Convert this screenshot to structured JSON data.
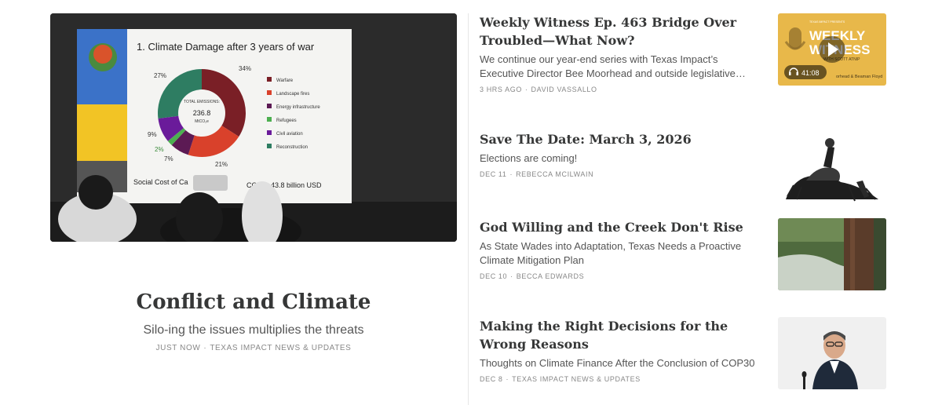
{
  "featured": {
    "title": "Conflict and Climate",
    "subtitle": "Silo-ing the issues multiplies the threats",
    "date": "JUST NOW",
    "author": "TEXAS IMPACT NEWS & UPDATES",
    "image": {
      "slide_title": "1. Climate Damage after 3 years of war",
      "center_label": "TOTAL EMISSIONS:",
      "center_value": "236.8",
      "center_unit": "MtCO₂e",
      "footer": "Social Cost of Ca",
      "footer_tail": "CO₂ → 43.8 billion USD",
      "slices": [
        {
          "label": "Warfare",
          "value": 34,
          "color": "#7a1f26",
          "pct": "34%"
        },
        {
          "label": "Landscape fires",
          "value": 21,
          "color": "#d9412b",
          "pct": "21%"
        },
        {
          "label": "Energy infrastructure",
          "value": 7,
          "color": "#5c1a54",
          "pct": "7%"
        },
        {
          "label": "Refugees",
          "value": 2,
          "color": "#4caf50",
          "pct": "2%"
        },
        {
          "label": "Civil aviation",
          "value": 9,
          "color": "#6a1b9a",
          "pct": "9%"
        },
        {
          "label": "Reconstruction",
          "value": 27,
          "color": "#2e7d62",
          "pct": "27%"
        }
      ]
    }
  },
  "posts": [
    {
      "title": "Weekly Witness Ep. 463 Bridge Over Troubled—What Now?",
      "subtitle": "We continue our year-end series with Texas Impact’s Executive Director Bee Moorhead and outside legislative…",
      "date": "3 HRS AGO",
      "author": "DAVID VASSALLO",
      "thumb": {
        "kind": "podcast",
        "small": "TEXAS IMPACT PRESENTS",
        "big1": "WEEKLY",
        "big2": "WITNESS",
        "guest": "WITH SCOTT ATNIP",
        "bottom": "orhead & Beaman Floyd",
        "duration": "41:08",
        "bg": "#e8b84a"
      }
    },
    {
      "title": "Save The Date: March 3, 2026",
      "subtitle": "Elections are coming!",
      "date": "DEC 11",
      "author": "REBECCA MCILWAIN",
      "thumb": {
        "kind": "engraving"
      }
    },
    {
      "title": "God Willing and the Creek Don't Rise",
      "subtitle": "As State Wades into Adaptation, Texas Needs a Proactive Climate Mitigation Plan",
      "date": "DEC 10",
      "author": "BECCA EDWARDS",
      "thumb": {
        "kind": "creek"
      }
    },
    {
      "title": "Making the Right Decisions for the Wrong Reasons",
      "subtitle": "Thoughts on Climate Finance After the Conclusion of COP30",
      "date": "DEC 8",
      "author": "TEXAS IMPACT NEWS & UPDATES",
      "thumb": {
        "kind": "portrait"
      }
    }
  ]
}
